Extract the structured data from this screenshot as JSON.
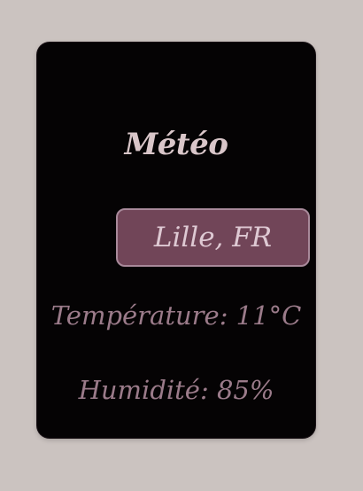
{
  "card": {
    "title": "Météo",
    "city": "Lille, FR",
    "temperature_text": "Température: 11°C",
    "humidity_text": "Humidité: 85%"
  },
  "colors": {
    "page_background": "#cbc3c0",
    "card_background": "#050304",
    "accent": "#714558",
    "accent_border": "#a8899a",
    "title_text": "#d9c6c9",
    "stat_text": "#9b7b8a"
  }
}
